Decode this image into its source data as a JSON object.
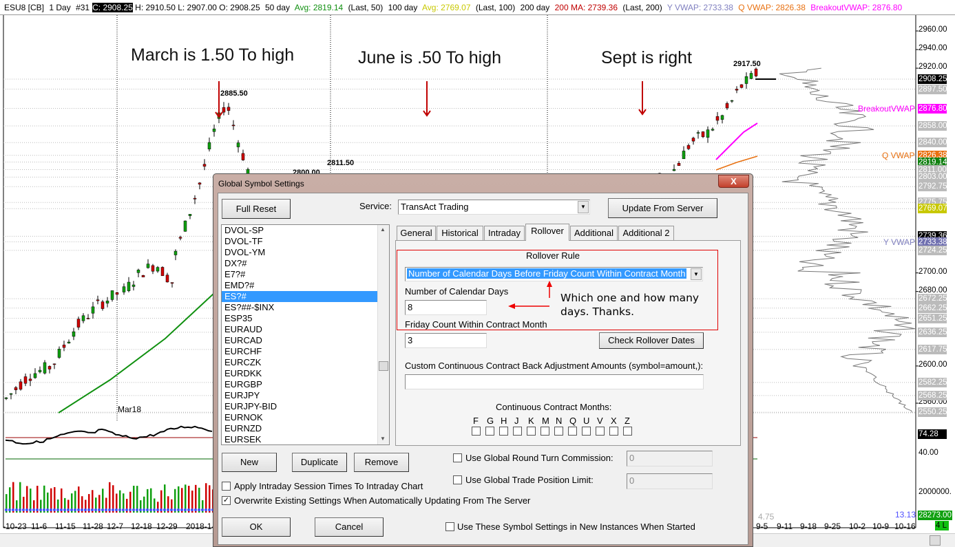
{
  "header": {
    "symbol": "ESU8 [CB]",
    "period": "1 Day",
    "bar": "#31",
    "close": "C: 2908.25",
    "hlo": "H: 2910.50 L: 2907.00 O: 2908.25",
    "ma50_pre": "50 day",
    "ma50": "Avg: 2819.14",
    "ma50_post": "(Last, 50)",
    "ma100_pre": "100 day",
    "ma100": "Avg: 2769.07",
    "ma100_post": "(Last, 100)",
    "ma200_pre": "200 day",
    "ma200": "200 MA: 2739.36",
    "ma200_post": "(Last, 200)",
    "yvwap": "Y VWAP: 2733.38",
    "qvwap": "Q VWAP: 2826.38",
    "bvwap": "BreakoutVWAP: 2876.80"
  },
  "annotations": {
    "march": "March is 1.50 To high",
    "june": "June is .50 To high",
    "sept": "Sept is right",
    "question": "Which one and how many",
    "question2": "days. Thanks."
  },
  "chart": {
    "hi_labels": [
      "2885.50",
      "2811.50",
      "2800.00",
      "2917.50"
    ],
    "contract_label": "Mar18",
    "line_labels": {
      "breakout": "BreakoutVWAP",
      "q": "Q VWAP",
      "y": "Y VWAP"
    },
    "ticks": [
      "2960.00",
      "2940.00",
      "2920.00",
      "2700.00",
      "2680.00",
      "2600.00",
      "2560.00"
    ],
    "price_labels": [
      {
        "v": "2908.25",
        "c": "#000000"
      },
      {
        "v": "2897.50",
        "c": "#bbbbbb"
      },
      {
        "v": "2876.80",
        "c": "#ff00ff"
      },
      {
        "v": "2858.00",
        "c": "#bbbbbb"
      },
      {
        "v": "2840.00",
        "c": "#bbbbbb"
      },
      {
        "v": "2826.38",
        "c": "#e87010"
      },
      {
        "v": "2819.14",
        "c": "#108010"
      },
      {
        "v": "2811.00",
        "c": "#bbbbbb"
      },
      {
        "v": "2803.00",
        "c": "#bbbbbb"
      },
      {
        "v": "2792.75",
        "c": "#bbbbbb"
      },
      {
        "v": "2775.75",
        "c": "#bbbbbb"
      },
      {
        "v": "2769.07",
        "c": "#c8c800"
      },
      {
        "v": "2739.36",
        "c": "#000000"
      },
      {
        "v": "2733.38",
        "c": "#7070b0"
      },
      {
        "v": "2724.25",
        "c": "#bbbbbb"
      },
      {
        "v": "2672.25",
        "c": "#bbbbbb"
      },
      {
        "v": "2662.25",
        "c": "#bbbbbb"
      },
      {
        "v": "2651.25",
        "c": "#bbbbbb"
      },
      {
        "v": "2636.25",
        "c": "#bbbbbb"
      },
      {
        "v": "2617.75",
        "c": "#bbbbbb"
      },
      {
        "v": "2582.25",
        "c": "#bbbbbb"
      },
      {
        "v": "2568.25",
        "c": "#bbbbbb"
      },
      {
        "v": "2550.25",
        "c": "#bbbbbb"
      }
    ],
    "osc_value": "74.28",
    "osc_tick": "40.00",
    "vol_tick": "2000000.",
    "vol_value": "28273.00",
    "vol_small": "13.13",
    "vol_left": "4.75",
    "position": "4 L",
    "xlabels": [
      "-10-23",
      "11-6",
      "11-15",
      "11-28",
      "12-7",
      "12-18",
      "12-29",
      "2018-1-",
      "9-5",
      "9-11",
      "9-18",
      "9-25",
      "10-2",
      "10-9",
      "10-16"
    ]
  },
  "dialog": {
    "title": "Global Symbol Settings",
    "close": "X",
    "full_reset": "Full Reset",
    "service_label": "Service:",
    "service_value": "TransAct Trading",
    "update": "Update From Server",
    "symbols": [
      "DVOL-SP",
      "DVOL-TF",
      "DVOL-YM",
      "DX?#",
      "E7?#",
      "EMD?#",
      "ES?#",
      "ES?##-$INX",
      "ESP35",
      "EURAUD",
      "EURCAD",
      "EURCHF",
      "EURCZK",
      "EURDKK",
      "EURGBP",
      "EURJPY",
      "EURJPY-BID",
      "EURNOK",
      "EURNZD",
      "EURSEK"
    ],
    "selected_symbol": "ES?#",
    "tabs": [
      "General",
      "Historical",
      "Intraday",
      "Rollover",
      "Additional",
      "Additional 2"
    ],
    "active_tab": "Rollover",
    "rollover_rule_label": "Rollover Rule",
    "rollover_rule": "Number of Calendar Days Before Friday Count Within Contract Month",
    "days_label": "Number of Calendar Days",
    "days": "8",
    "friday_label": "Friday Count Within Contract Month",
    "friday": "3",
    "check_dates": "Check Rollover Dates",
    "custom_label": "Custom Continuous Contract Back Adjustment Amounts (symbol=amount,):",
    "custom_value": "",
    "months_label": "Continuous Contract Months:",
    "months": [
      "F",
      "G",
      "H",
      "J",
      "K",
      "M",
      "N",
      "Q",
      "U",
      "V",
      "X",
      "Z"
    ],
    "new": "New",
    "duplicate": "Duplicate",
    "remove": "Remove",
    "round_turn_label": "Use Global Round Turn Commission:",
    "round_turn": "0",
    "pos_limit_label": "Use Global Trade Position Limit:",
    "pos_limit": "0",
    "apply_session": "Apply Intraday Session Times To Intraday Chart",
    "overwrite": "Overwrite Existing Settings When Automatically Updating From The Server",
    "ok": "OK",
    "cancel": "Cancel",
    "use_new": "Use These Symbol Settings in New Instances When Started"
  }
}
